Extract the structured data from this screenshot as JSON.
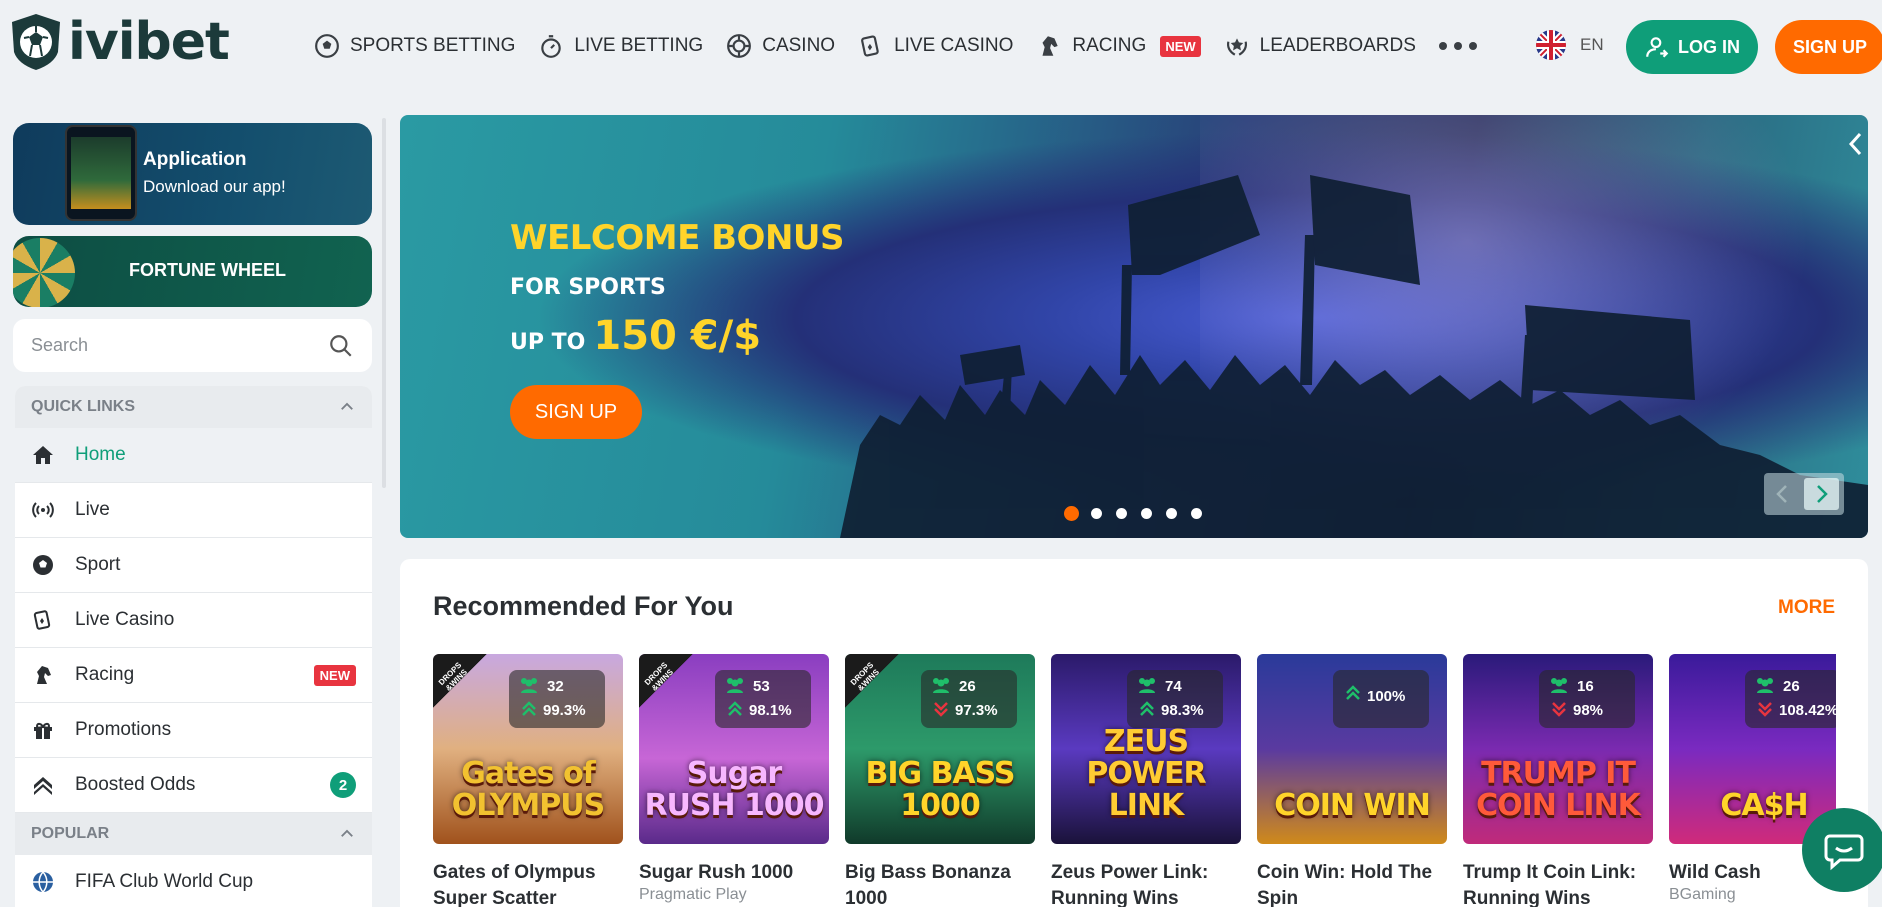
{
  "header": {
    "logo_text": "ivibet",
    "nav": [
      {
        "label": "SPORTS BETTING",
        "icon": "soccer-ball-icon"
      },
      {
        "label": "LIVE BETTING",
        "icon": "stopwatch-icon"
      },
      {
        "label": "CASINO",
        "icon": "casino-chip-icon"
      },
      {
        "label": "LIVE CASINO",
        "icon": "cards-icon"
      },
      {
        "label": "RACING",
        "icon": "horse-icon",
        "badge": "NEW"
      },
      {
        "label": "LEADERBOARDS",
        "icon": "laurel-star-icon"
      }
    ],
    "language": "EN",
    "login_label": "LOG IN",
    "signup_label": "SIGN UP"
  },
  "sidebar": {
    "app_promo": {
      "title": "Application",
      "subtitle": "Download our app!"
    },
    "wheel_promo": {
      "title": "FORTUNE WHEEL"
    },
    "search_placeholder": "Search",
    "quick_links_title": "QUICK LINKS",
    "items": [
      {
        "label": "Home",
        "icon": "home-icon",
        "active": true
      },
      {
        "label": "Live",
        "icon": "broadcast-icon"
      },
      {
        "label": "Sport",
        "icon": "soccer-ball-icon"
      },
      {
        "label": "Live Casino",
        "icon": "cards-icon"
      },
      {
        "label": "Racing",
        "icon": "horse-icon",
        "badge": "NEW"
      },
      {
        "label": "Promotions",
        "icon": "gift-icon"
      },
      {
        "label": "Boosted Odds",
        "icon": "double-chevron-up-icon",
        "count": "2"
      }
    ],
    "popular_title": "POPULAR",
    "popular_items": [
      {
        "label": "FIFA Club World Cup",
        "icon": "globe-icon"
      }
    ]
  },
  "banner": {
    "title": "WELCOME BONUS",
    "subtitle": "FOR SPORTS",
    "upto": "UP TO",
    "amount": "150 €/$",
    "button": "SIGN UP",
    "slides": 6,
    "active_slide": 1
  },
  "recommended": {
    "title": "Recommended For You",
    "more": "MORE",
    "games": [
      {
        "name": "Gates of Olympus Super Scatter",
        "provider": "",
        "players": "32",
        "rtp": "99.3%",
        "trend": "up",
        "drops": true,
        "art": "Gates of OLYMPUS",
        "art_color": "#f2c230",
        "bg": "linear-gradient(#c8a8e0,#e0b080 50%,#a0521c)"
      },
      {
        "name": "Sugar Rush 1000",
        "provider": "Pragmatic Play",
        "players": "53",
        "rtp": "98.1%",
        "trend": "up",
        "drops": true,
        "art": "Sugar RUSH 1000",
        "art_color": "#f7b7ff",
        "bg": "linear-gradient(#8a3ec0,#c766d6 55%,#5a2a8a)"
      },
      {
        "name": "Big Bass Bonanza 1000",
        "provider": "",
        "players": "26",
        "rtp": "97.3%",
        "trend": "down",
        "drops": true,
        "art": "BIG BASS 1000",
        "art_color": "#ffd42a",
        "bg": "linear-gradient(#1e7a5a,#2d9a6a 50%,#103a2a)"
      },
      {
        "name": "Zeus Power Link: Running Wins",
        "provider": "",
        "players": "74",
        "rtp": "98.3%",
        "trend": "up",
        "drops": false,
        "art": "ZEUS POWER LINK",
        "art_color": "#ffcc33",
        "bg": "linear-gradient(#2b1a6a,#5a3ac0 50%,#1a123a)"
      },
      {
        "name": "Coin Win: Hold The Spin",
        "provider": "",
        "players": "",
        "rtp": "100%",
        "trend": "up",
        "drops": false,
        "art": "COIN WIN",
        "art_color": "#ffd42a",
        "bg": "linear-gradient(#2a3a9a,#5a3aa0 50%,#d08a1a)"
      },
      {
        "name": "Trump It Coin Link: Running Wins",
        "provider": "",
        "players": "16",
        "rtp": "98%",
        "trend": "down",
        "drops": false,
        "art": "TRUMP IT COIN LINK",
        "art_color": "#ff5a3a",
        "bg": "linear-gradient(#2a1a7a,#7a2ab0 50%,#c02a7a)"
      },
      {
        "name": "Wild Cash",
        "provider": "BGaming",
        "players": "26",
        "rtp": "108.42%",
        "trend": "down",
        "drops": false,
        "art": "CA$H",
        "art_color": "#ffd42a",
        "bg": "linear-gradient(#3a1a9a,#7a2ac0 50%,#d02a7a)"
      }
    ]
  },
  "colors": {
    "accent": "#0f9e79",
    "brand_orange": "#ff6a00",
    "new_badge": "#e8343f"
  }
}
